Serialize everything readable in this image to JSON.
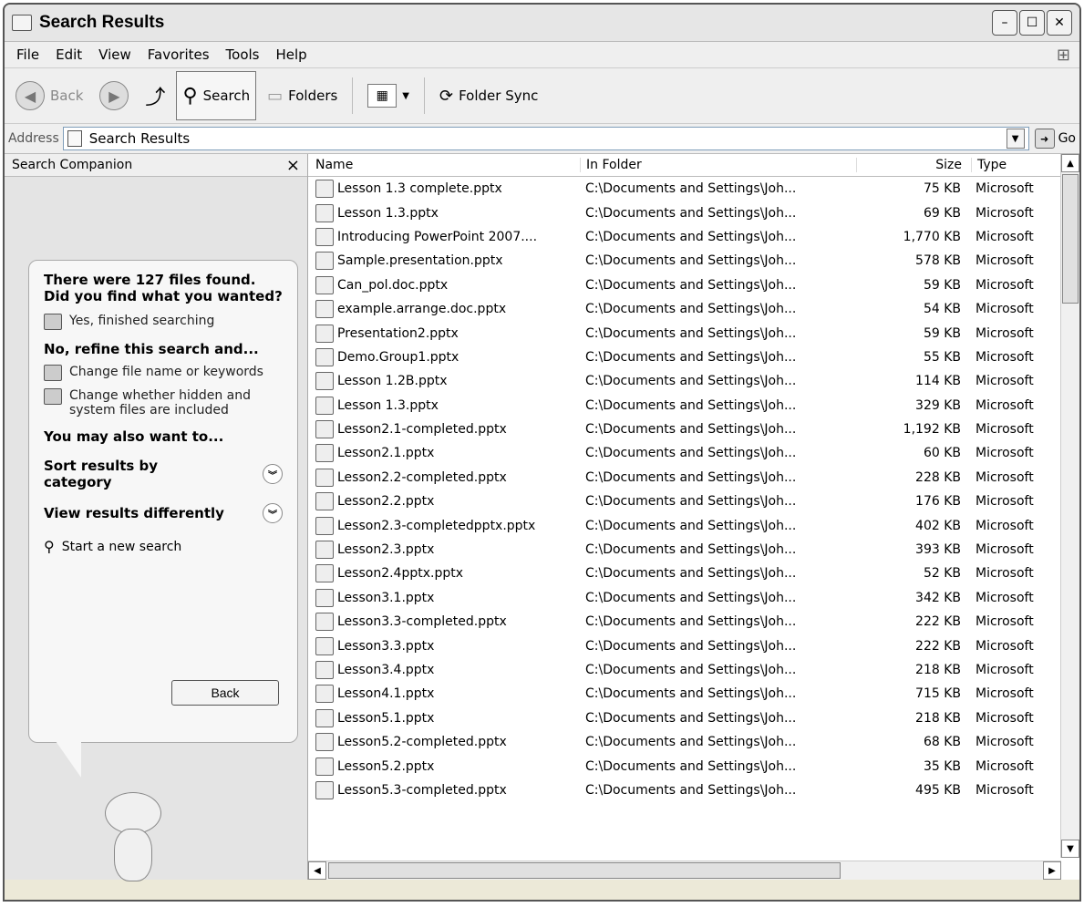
{
  "window": {
    "title": "Search Results"
  },
  "menu": [
    "File",
    "Edit",
    "View",
    "Favorites",
    "Tools",
    "Help"
  ],
  "toolbar": {
    "back_label": "Back",
    "search_label": "Search",
    "folders_label": "Folders",
    "folder_sync_label": "Folder Sync"
  },
  "address": {
    "label": "Address",
    "value": "Search Results",
    "go_label": "Go"
  },
  "sidebar": {
    "header": "Search Companion",
    "results_title": "There were 127 files found. Did you find what you wanted?",
    "yes_label": "Yes, finished searching",
    "refine_title": "No, refine this search and...",
    "change_name_label": "Change file name or keywords",
    "change_hidden_label": "Change whether hidden and system files are included",
    "also_title": "You may also want to...",
    "sort_label": "Sort results by category",
    "view_label": "View results differently",
    "new_search_label": "Start a new search",
    "back_button": "Back"
  },
  "columns": {
    "name": "Name",
    "folder": "In Folder",
    "size": "Size",
    "type": "Type"
  },
  "files": [
    {
      "name": "Lesson 1.3 complete.pptx",
      "folder": "C:\\Documents and Settings\\Joh...",
      "size": "75 KB",
      "type": "Microsoft"
    },
    {
      "name": "Lesson 1.3.pptx",
      "folder": "C:\\Documents and Settings\\Joh...",
      "size": "69 KB",
      "type": "Microsoft"
    },
    {
      "name": "Introducing PowerPoint 2007....",
      "folder": "C:\\Documents and Settings\\Joh...",
      "size": "1,770 KB",
      "type": "Microsoft"
    },
    {
      "name": "Sample.presentation.pptx",
      "folder": "C:\\Documents and Settings\\Joh...",
      "size": "578 KB",
      "type": "Microsoft"
    },
    {
      "name": "Can_pol.doc.pptx",
      "folder": "C:\\Documents and Settings\\Joh...",
      "size": "59 KB",
      "type": "Microsoft"
    },
    {
      "name": "example.arrange.doc.pptx",
      "folder": "C:\\Documents and Settings\\Joh...",
      "size": "54 KB",
      "type": "Microsoft"
    },
    {
      "name": "Presentation2.pptx",
      "folder": "C:\\Documents and Settings\\Joh...",
      "size": "59 KB",
      "type": "Microsoft"
    },
    {
      "name": "Demo.Group1.pptx",
      "folder": "C:\\Documents and Settings\\Joh...",
      "size": "55 KB",
      "type": "Microsoft"
    },
    {
      "name": "Lesson 1.2B.pptx",
      "folder": "C:\\Documents and Settings\\Joh...",
      "size": "114 KB",
      "type": "Microsoft"
    },
    {
      "name": "Lesson 1.3.pptx",
      "folder": "C:\\Documents and Settings\\Joh...",
      "size": "329 KB",
      "type": "Microsoft"
    },
    {
      "name": "Lesson2.1-completed.pptx",
      "folder": "C:\\Documents and Settings\\Joh...",
      "size": "1,192 KB",
      "type": "Microsoft"
    },
    {
      "name": "Lesson2.1.pptx",
      "folder": "C:\\Documents and Settings\\Joh...",
      "size": "60 KB",
      "type": "Microsoft"
    },
    {
      "name": "Lesson2.2-completed.pptx",
      "folder": "C:\\Documents and Settings\\Joh...",
      "size": "228 KB",
      "type": "Microsoft"
    },
    {
      "name": "Lesson2.2.pptx",
      "folder": "C:\\Documents and Settings\\Joh...",
      "size": "176 KB",
      "type": "Microsoft"
    },
    {
      "name": "Lesson2.3-completedpptx.pptx",
      "folder": "C:\\Documents and Settings\\Joh...",
      "size": "402 KB",
      "type": "Microsoft"
    },
    {
      "name": "Lesson2.3.pptx",
      "folder": "C:\\Documents and Settings\\Joh...",
      "size": "393 KB",
      "type": "Microsoft"
    },
    {
      "name": "Lesson2.4pptx.pptx",
      "folder": "C:\\Documents and Settings\\Joh...",
      "size": "52 KB",
      "type": "Microsoft"
    },
    {
      "name": "Lesson3.1.pptx",
      "folder": "C:\\Documents and Settings\\Joh...",
      "size": "342 KB",
      "type": "Microsoft"
    },
    {
      "name": "Lesson3.3-completed.pptx",
      "folder": "C:\\Documents and Settings\\Joh...",
      "size": "222 KB",
      "type": "Microsoft"
    },
    {
      "name": "Lesson3.3.pptx",
      "folder": "C:\\Documents and Settings\\Joh...",
      "size": "222 KB",
      "type": "Microsoft"
    },
    {
      "name": "Lesson3.4.pptx",
      "folder": "C:\\Documents and Settings\\Joh...",
      "size": "218 KB",
      "type": "Microsoft"
    },
    {
      "name": "Lesson4.1.pptx",
      "folder": "C:\\Documents and Settings\\Joh...",
      "size": "715 KB",
      "type": "Microsoft"
    },
    {
      "name": "Lesson5.1.pptx",
      "folder": "C:\\Documents and Settings\\Joh...",
      "size": "218 KB",
      "type": "Microsoft"
    },
    {
      "name": "Lesson5.2-completed.pptx",
      "folder": "C:\\Documents and Settings\\Joh...",
      "size": "68 KB",
      "type": "Microsoft"
    },
    {
      "name": "Lesson5.2.pptx",
      "folder": "C:\\Documents and Settings\\Joh...",
      "size": "35 KB",
      "type": "Microsoft"
    },
    {
      "name": "Lesson5.3-completed.pptx",
      "folder": "C:\\Documents and Settings\\Joh...",
      "size": "495 KB",
      "type": "Microsoft"
    }
  ],
  "icons": {
    "back": "back-arrow-icon",
    "forward": "forward-arrow-icon",
    "up": "up-folder-icon",
    "search": "magnifier-icon",
    "folders": "folders-icon",
    "views": "views-grid-icon",
    "folder_sync": "folder-sync-icon",
    "file": "pptx-file-icon"
  }
}
